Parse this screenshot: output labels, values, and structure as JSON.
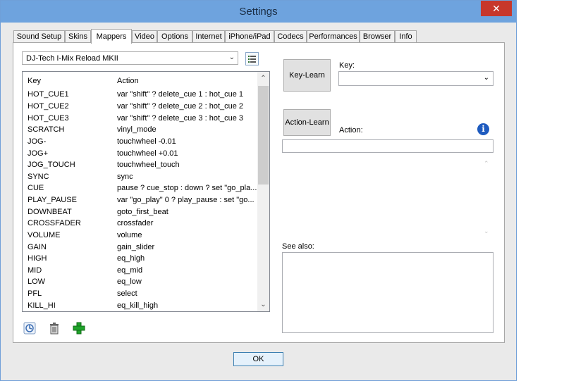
{
  "window": {
    "title": "Settings",
    "close_glyph": "✕"
  },
  "tabs": [
    {
      "label": "Sound Setup"
    },
    {
      "label": "Skins"
    },
    {
      "label": "Mappers",
      "active": true
    },
    {
      "label": "Video"
    },
    {
      "label": "Options"
    },
    {
      "label": "Internet"
    },
    {
      "label": "iPhone/iPad"
    },
    {
      "label": "Codecs"
    },
    {
      "label": "Performances"
    },
    {
      "label": "Browser"
    },
    {
      "label": "Info"
    }
  ],
  "mapper": {
    "selected_device": "DJ-Tech I-Mix Reload MKII",
    "dropdown_arrow": "⌄"
  },
  "list": {
    "col_key": "Key",
    "col_action": "Action",
    "rows": [
      {
        "key": "HOT_CUE1",
        "action": "var \"shift\" ? delete_cue 1 : hot_cue 1"
      },
      {
        "key": "HOT_CUE2",
        "action": "var \"shift\" ? delete_cue 2 : hot_cue 2"
      },
      {
        "key": "HOT_CUE3",
        "action": "var \"shift\" ? delete_cue 3 : hot_cue 3"
      },
      {
        "key": "SCRATCH",
        "action": "vinyl_mode"
      },
      {
        "key": "JOG-",
        "action": "touchwheel -0.01"
      },
      {
        "key": "JOG+",
        "action": "touchwheel +0.01"
      },
      {
        "key": "JOG_TOUCH",
        "action": "touchwheel_touch"
      },
      {
        "key": "SYNC",
        "action": "sync"
      },
      {
        "key": "CUE",
        "action": "pause ? cue_stop : down ? set \"go_pla..."
      },
      {
        "key": "PLAY_PAUSE",
        "action": "var \"go_play\" 0 ? play_pause : set \"go..."
      },
      {
        "key": "DOWNBEAT",
        "action": "goto_first_beat"
      },
      {
        "key": "CROSSFADER",
        "action": "crossfader"
      },
      {
        "key": "VOLUME",
        "action": "volume"
      },
      {
        "key": "GAIN",
        "action": "gain_slider"
      },
      {
        "key": "HIGH",
        "action": "eq_high"
      },
      {
        "key": "MID",
        "action": "eq_mid"
      },
      {
        "key": "LOW",
        "action": "eq_low"
      },
      {
        "key": "PFL",
        "action": "select"
      },
      {
        "key": "KILL_HI",
        "action": "eq_kill_high"
      }
    ],
    "scroll_up": "⌃",
    "scroll_down": "⌄"
  },
  "right": {
    "key_learn_label": "Key-Learn",
    "key_label": "Key:",
    "key_value": "",
    "action_learn_label": "Action-Learn",
    "action_label": "Action:",
    "action_value": "",
    "info_glyph": "i",
    "see_also_label": "See also:",
    "see_also_value": ""
  },
  "footer": {
    "ok_label": "OK"
  },
  "colors": {
    "titlebar": "#6ea3de",
    "close": "#c7372b",
    "add_icon": "#1fa32a"
  }
}
